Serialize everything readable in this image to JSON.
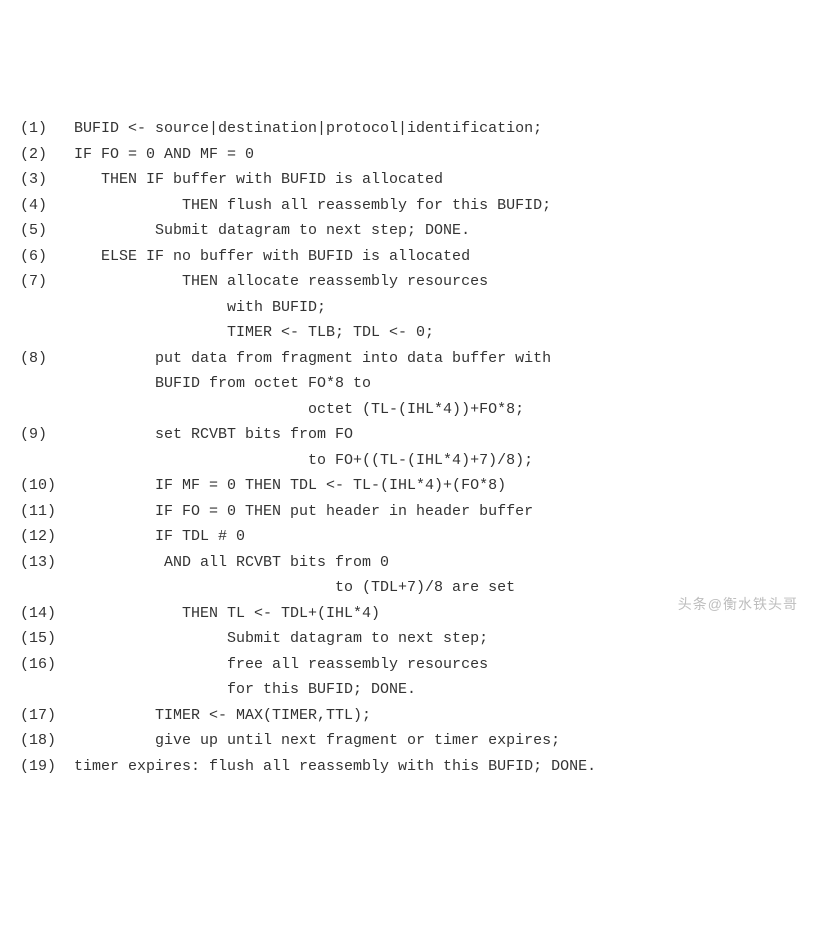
{
  "lines": [
    {
      "num": "(1)",
      "text": "BUFID <- source|destination|protocol|identification;"
    },
    {
      "num": "(2)",
      "text": "IF FO = 0 AND MF = 0"
    },
    {
      "num": "(3)",
      "text": "   THEN IF buffer with BUFID is allocated"
    },
    {
      "num": "(4)",
      "text": "            THEN flush all reassembly for this BUFID;"
    },
    {
      "num": "(5)",
      "text": "         Submit datagram to next step; DONE."
    },
    {
      "num": "(6)",
      "text": "   ELSE IF no buffer with BUFID is allocated"
    },
    {
      "num": "(7)",
      "text": "            THEN allocate reassembly resources"
    },
    {
      "num": "",
      "text": "                 with BUFID;"
    },
    {
      "num": "",
      "text": "                 TIMER <- TLB; TDL <- 0;"
    },
    {
      "num": "(8)",
      "text": "         put data from fragment into data buffer with"
    },
    {
      "num": "",
      "text": "         BUFID from octet FO*8 to"
    },
    {
      "num": "",
      "text": "                          octet (TL-(IHL*4))+FO*8;"
    },
    {
      "num": "(9)",
      "text": "         set RCVBT bits from FO"
    },
    {
      "num": "",
      "text": "                          to FO+((TL-(IHL*4)+7)/8);"
    },
    {
      "num": "(10)",
      "text": "         IF MF = 0 THEN TDL <- TL-(IHL*4)+(FO*8)"
    },
    {
      "num": "(11)",
      "text": "         IF FO = 0 THEN put header in header buffer"
    },
    {
      "num": "(12)",
      "text": "         IF TDL # 0"
    },
    {
      "num": "(13)",
      "text": "          AND all RCVBT bits from 0"
    },
    {
      "num": "",
      "text": "                             to (TDL+7)/8 are set"
    },
    {
      "num": "(14)",
      "text": "            THEN TL <- TDL+(IHL*4)"
    },
    {
      "num": "(15)",
      "text": "                 Submit datagram to next step;"
    },
    {
      "num": "(16)",
      "text": "                 free all reassembly resources"
    },
    {
      "num": "",
      "text": "                 for this BUFID; DONE."
    },
    {
      "num": "(17)",
      "text": "         TIMER <- MAX(TIMER,TTL);"
    },
    {
      "num": "(18)",
      "text": "         give up until next fragment or timer expires;"
    },
    {
      "num": "(19)",
      "text": "timer expires: flush all reassembly with this BUFID; DONE."
    }
  ],
  "watermark": "头条@衡水铁头哥"
}
